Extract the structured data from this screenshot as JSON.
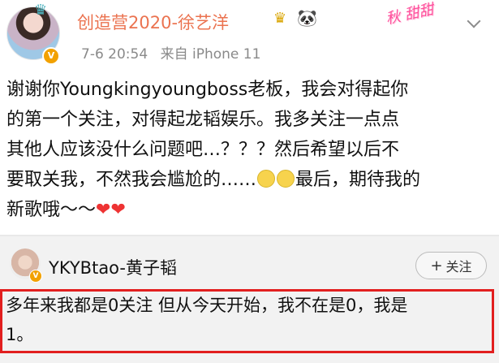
{
  "post": {
    "author": "创造营2020-徐艺洋",
    "timestamp": "7-6 20:54",
    "source": "来自 iPhone 11",
    "text_lines": [
      "谢谢你Youngkingyoungboss老板，我会对得起你",
      "的第一个关注，对得起龙韬娱乐。我多关注一点点",
      "其他人应该没什么问题吧…？？？然后希望以后不",
      "要取关我，不然我会尴尬的……"
    ],
    "line4_tail": "最后，期待我的",
    "line5": "新歌哦～～",
    "decor_text": "秋 甜甜"
  },
  "comment": {
    "author": "YKYBtao-黄子韬",
    "follow_label": "关注",
    "text_lines": [
      "多年来我都是0关注 但从今天开始，我不在是0，我是",
      "1。"
    ]
  },
  "icons": {
    "verified": "V",
    "crown": "♛",
    "vip": "♛",
    "panda": "🐼",
    "plus": "+",
    "heart": "❤"
  },
  "colors": {
    "username": "#eb7350",
    "highlight_border": "#e21f1f",
    "verified_badge": "#f2a100"
  }
}
